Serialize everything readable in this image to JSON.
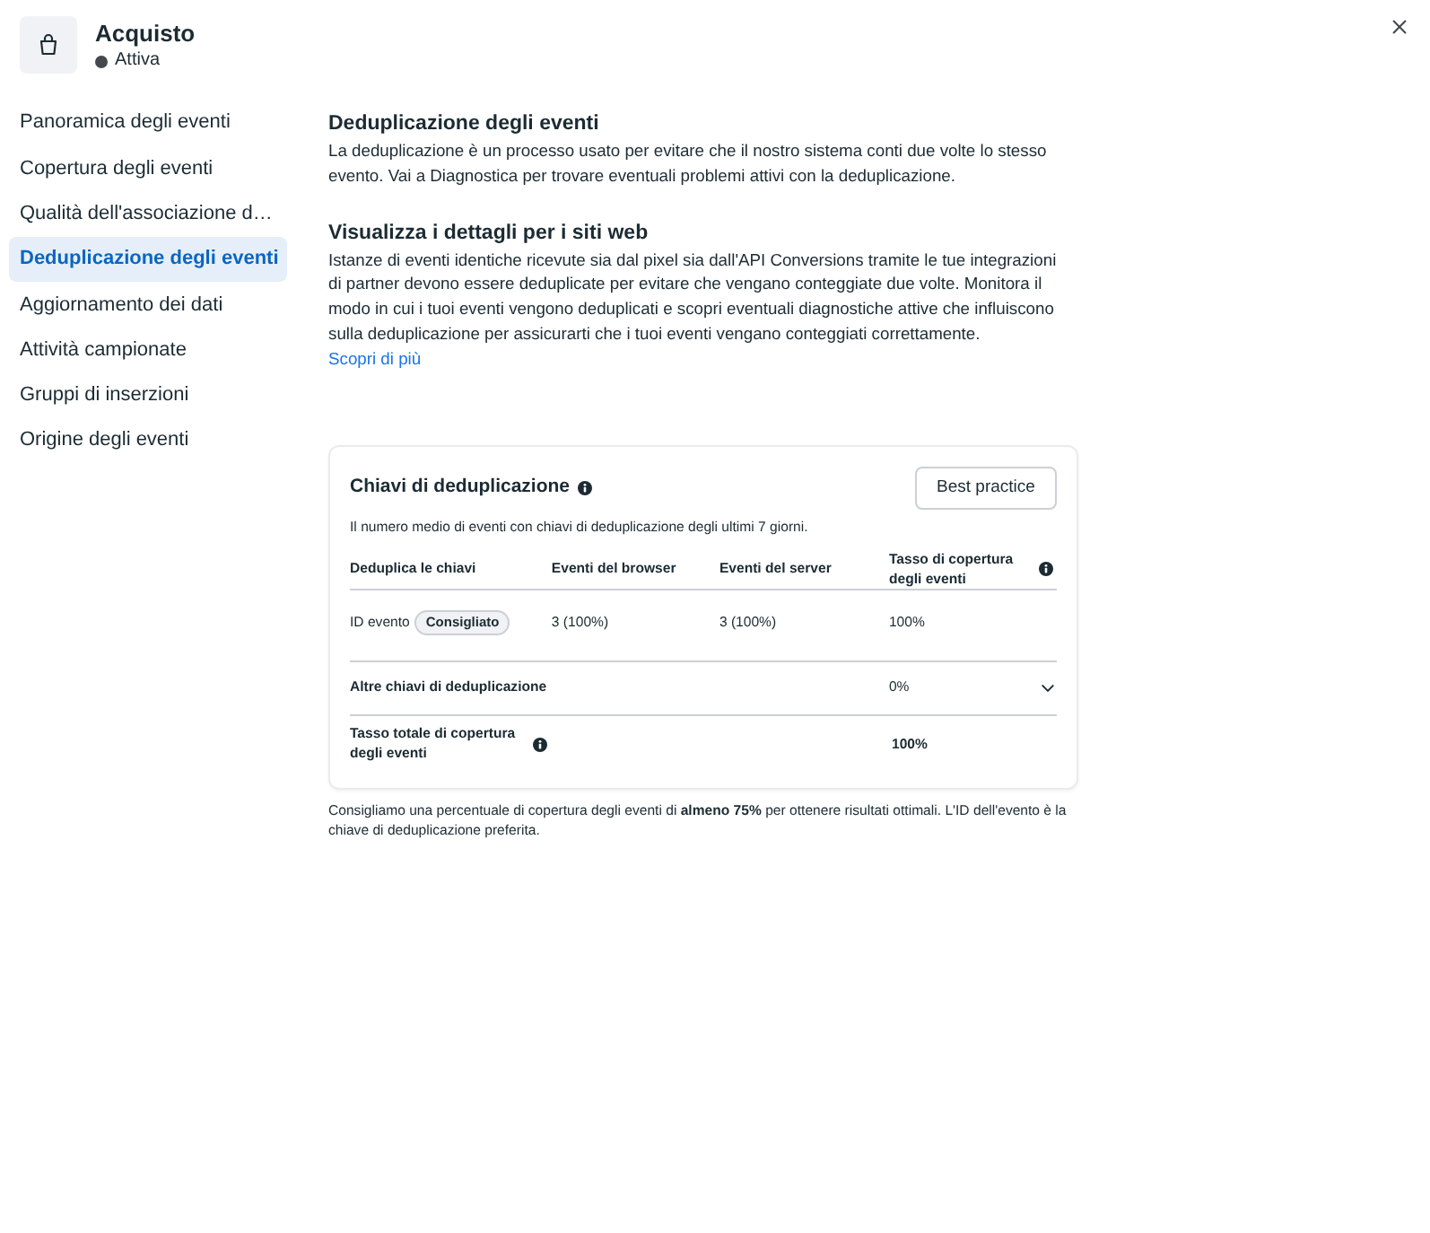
{
  "header": {
    "title": "Acquisto",
    "status": "Attiva"
  },
  "sidebar": {
    "items": [
      {
        "label": "Panoramica degli eventi",
        "selected": false
      },
      {
        "label": "Copertura degli eventi",
        "selected": false
      },
      {
        "label": "Qualità dell'associazione d…",
        "selected": false
      },
      {
        "label": "Deduplicazione degli eventi",
        "selected": true
      },
      {
        "label": "Aggiornamento dei dati",
        "selected": false
      },
      {
        "label": "Attività campionate",
        "selected": false
      },
      {
        "label": "Gruppi di inserzioni",
        "selected": false
      },
      {
        "label": "Origine degli eventi",
        "selected": false
      }
    ]
  },
  "sections": [
    {
      "title": "Deduplicazione degli eventi",
      "text": "La deduplicazione è un processo usato per evitare che il nostro sistema conti due volte lo stesso evento. Vai a Diagnostica per trovare eventuali problemi attivi con la deduplicazione."
    },
    {
      "title": "Visualizza i dettagli per i siti web",
      "text": "Istanze di eventi identiche ricevute sia dal pixel sia dall'API Conversions tramite le tue integrazioni di partner devono essere deduplicate per evitare che vengano conteggiate due volte. Monitora il modo in cui i tuoi eventi vengono deduplicati e scopri eventuali diagnostiche attive che influiscono sulla deduplicazione per assicurarti che i tuoi eventi vengano conteggiati correttamente.",
      "link": "Scopri di più"
    }
  ],
  "card": {
    "title": "Chiavi di deduplicazione",
    "title_info": true,
    "button": "Best practice",
    "subtitle": "Il numero medio di eventi con chiavi di deduplicazione degli ultimi 7 giorni.",
    "table": {
      "columns": [
        {
          "label": "Deduplica le chiavi",
          "info": false
        },
        {
          "label": "Eventi del browser",
          "info": false
        },
        {
          "label": "Eventi del server",
          "info": false
        },
        {
          "label": "Tasso di copertura degli eventi",
          "info": true
        }
      ],
      "rows": [
        {
          "kind": "key",
          "cells": [
            "ID evento",
            "3 (100%)",
            "3 (100%)",
            "100%"
          ],
          "badge": "Consigliato"
        },
        {
          "kind": "expandable",
          "label": "Altre chiavi di deduplicazione",
          "value": "0%",
          "expanded": false
        },
        {
          "kind": "total",
          "label": "Tasso totale di copertura degli eventi",
          "value": "100%",
          "info": true
        }
      ]
    }
  },
  "footnote": "Consigliamo una percentuale di copertura degli eventi di **almeno 75%** per ottenere risultati ottimali. L'ID dell'evento è la chiave di deduplicazione preferita."
}
